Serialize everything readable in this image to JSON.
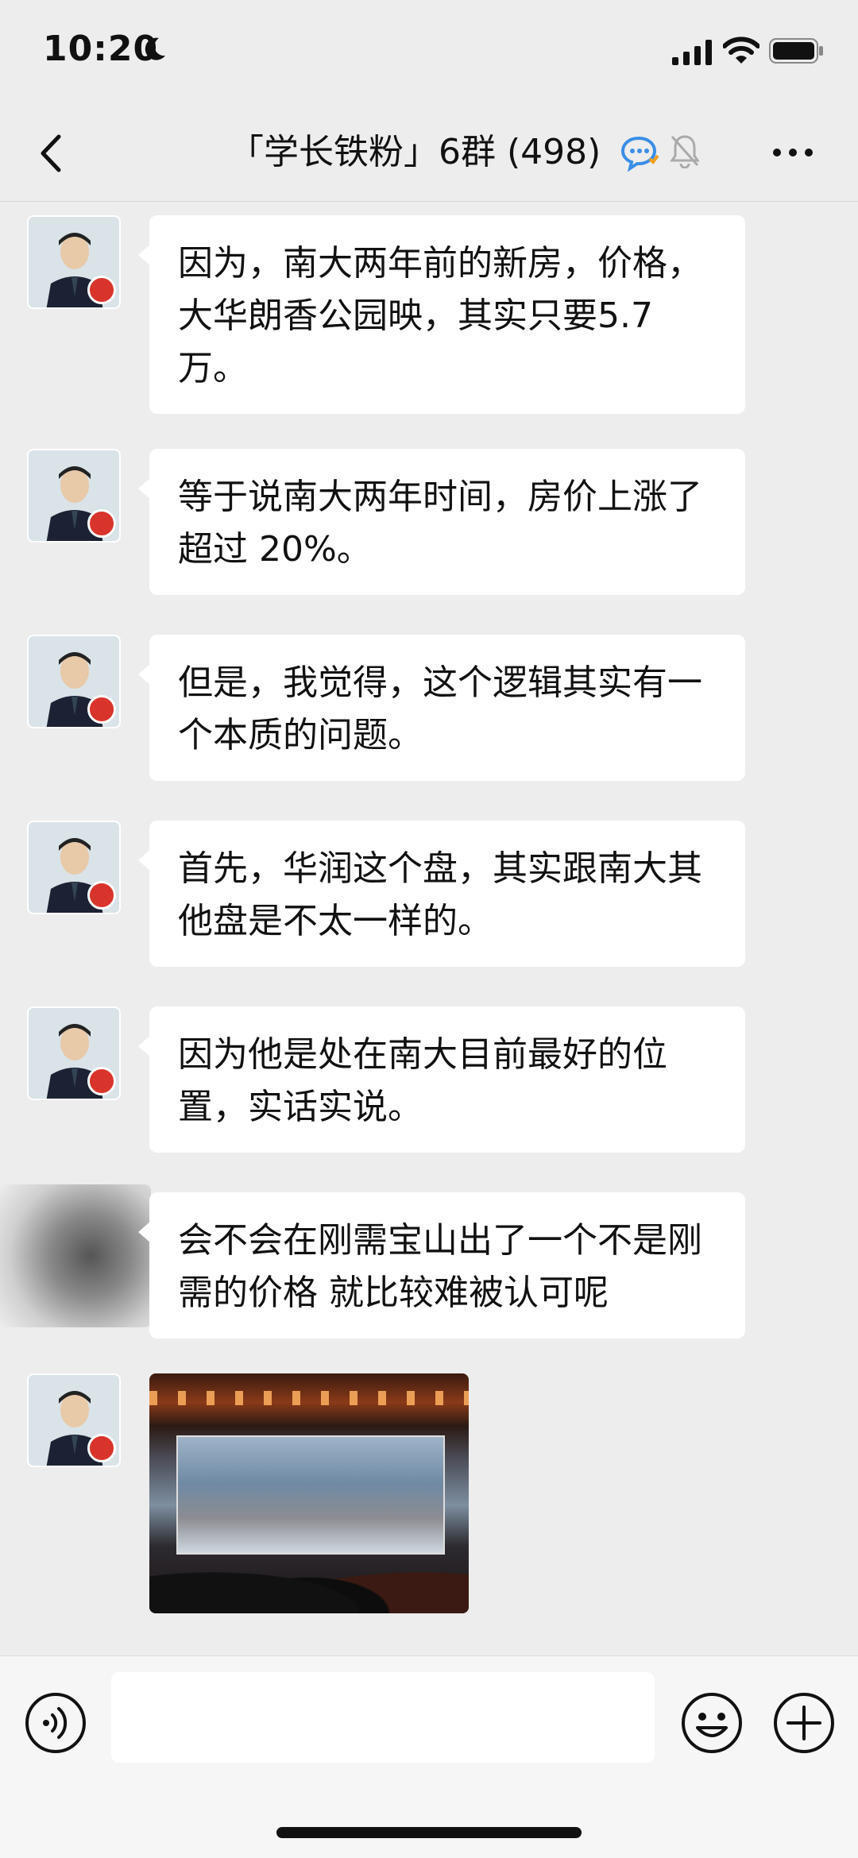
{
  "status_bar": {
    "time": "10:20",
    "icons": [
      "moon-icon",
      "signal-icon",
      "wifi-icon",
      "battery-icon"
    ]
  },
  "nav": {
    "title": "「学长铁粉」6群 (498)",
    "icons": [
      "back-icon",
      "group-chat-icon",
      "mute-bell-icon",
      "more-icon"
    ]
  },
  "messages": [
    {
      "sender": "host",
      "text": "因为，南大两年前的新房，价格，大华朗香公园映，其实只要5.7万。"
    },
    {
      "sender": "host",
      "text": "等于说南大两年时间，房价上涨了超过 20%。"
    },
    {
      "sender": "host",
      "text": "但是，我觉得，这个逻辑其实有一个本质的问题。"
    },
    {
      "sender": "host",
      "text": "首先，华润这个盘，其实跟南大其他盘是不太一样的。"
    },
    {
      "sender": "host",
      "text": "因为他是处在南大目前最好的位置，实话实说。"
    },
    {
      "sender": "member",
      "text": "会不会在刚需宝山出了一个不是刚需的价格 就比较难被认可呢"
    },
    {
      "sender": "host",
      "type": "image",
      "text": ""
    }
  ],
  "input_bar": {
    "value": "",
    "placeholder": "",
    "icons": [
      "voice-icon",
      "emoji-icon",
      "plus-icon"
    ]
  },
  "colors": {
    "background": "#ededed",
    "bubble": "#ffffff",
    "accent_blue": "#3a8ee6"
  }
}
